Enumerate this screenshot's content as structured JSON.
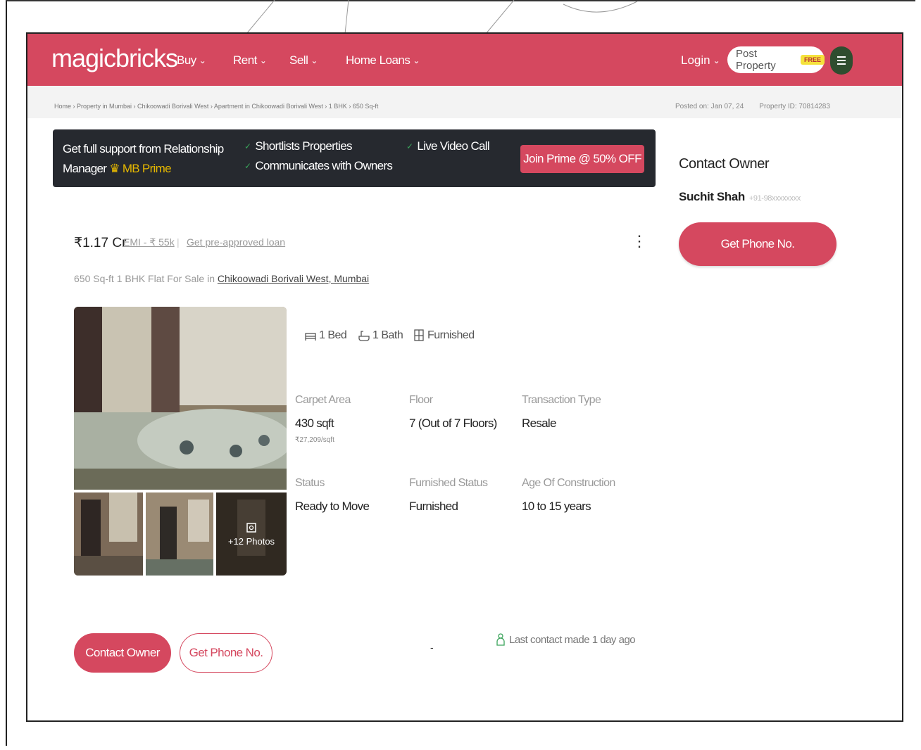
{
  "header": {
    "logo": "magicbricks",
    "nav": [
      "Buy",
      "Rent",
      "Sell",
      "Home Loans"
    ],
    "login": "Login",
    "post_property": "Post Property",
    "post_property_badge": "FREE",
    "menu_icon": "hamburger-icon"
  },
  "breadcrumb": "Home › Property in Mumbai › Chikoowadi Borivali West › Apartment in Chikoowadi Borivali West › 1 BHK › 650 Sq-ft",
  "meta": {
    "posted": "Posted on: Jan 07, 24",
    "property_id": "Property ID: 70814283"
  },
  "prime_banner": {
    "line1": "Get full support from Relationship",
    "line2_prefix": "Manager",
    "prime_link": "MB Prime",
    "feature1": "Shortlists Properties",
    "feature2": "Communicates with Owners",
    "feature3": "Live Video Call",
    "cta": "Join Prime @ 50% OFF"
  },
  "listing": {
    "price": "₹1.17 Cr",
    "emi": "EMI - ₹ 55k",
    "preapproved": "Get pre-approved loan",
    "title_prefix": "650 Sq-ft 1 BHK Flat For Sale in",
    "title_location": "Chikoowadi Borivali West, Mumbai",
    "more_photos": "+12 Photos",
    "amenities": [
      {
        "icon": "bed-icon",
        "label": "1 Bed"
      },
      {
        "icon": "bath-icon",
        "label": "1 Bath"
      },
      {
        "icon": "furnished-icon",
        "label": "Furnished"
      }
    ],
    "specs": {
      "carpet_area_label": "Carpet Area",
      "carpet_area_value": "430 sqft",
      "carpet_area_rate": "₹27,209/sqft",
      "floor_label": "Floor",
      "floor_value": "7 (Out of 7 Floors)",
      "transaction_label": "Transaction Type",
      "transaction_value": "Resale",
      "status_label": "Status",
      "status_value": "Ready to Move",
      "furnished_label": "Furnished Status",
      "furnished_value": "Furnished",
      "age_label": "Age Of Construction",
      "age_value": "10 to 15 years"
    },
    "contact_owner": "Contact Owner",
    "get_phone": "Get Phone No.",
    "last_contact": "Last contact made 1 day ago"
  },
  "sidebar": {
    "heading": "Contact Owner",
    "owner_name": "Suchit Shah",
    "owner_phone": "+91-98xxxxxxxx",
    "get_phone": "Get Phone No."
  },
  "colors": {
    "brand": "#d5485f",
    "banner_bg": "#26292f",
    "prime_gold": "#e6b800"
  }
}
